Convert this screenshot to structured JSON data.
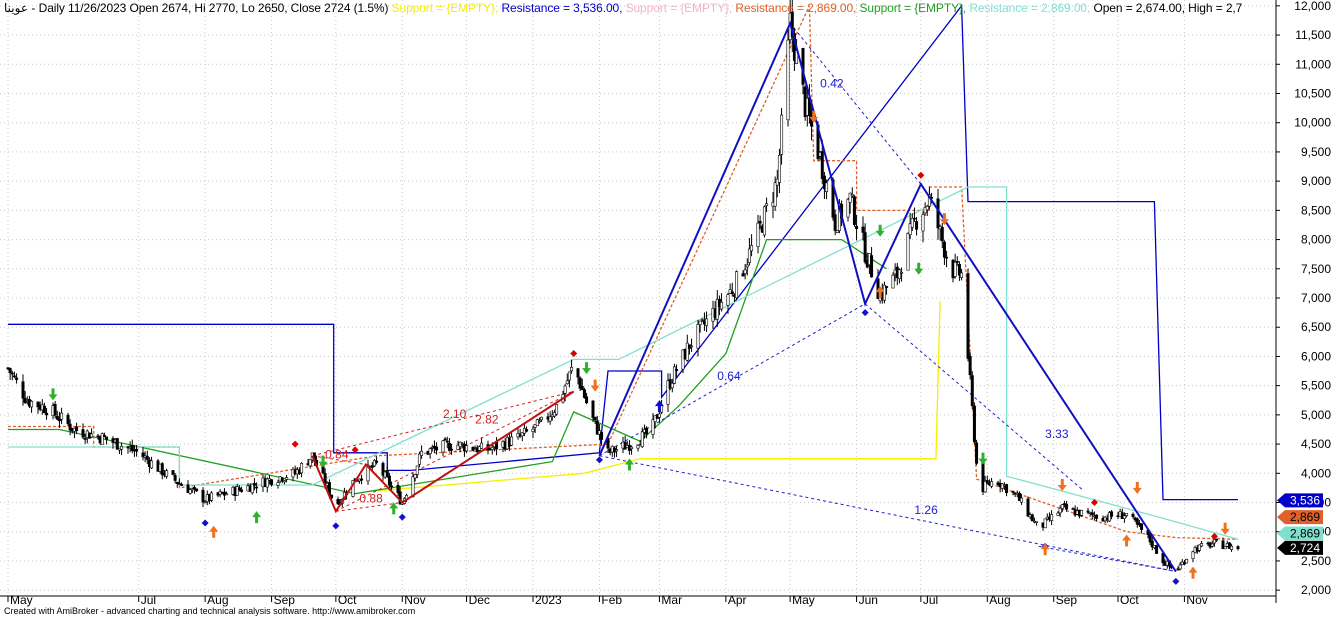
{
  "header": {
    "symbol": "عوينا",
    "summary": " - Daily 11/26/2023 Open 2674, Hi 2770, Lo 2650, Close 2724 (1.5%) ",
    "items": [
      {
        "text": "Support = {EMPTY}, ",
        "color": "#f4f000"
      },
      {
        "text": "Resistance = 3,536.00, ",
        "color": "#0000c8"
      },
      {
        "text": "Support = {EMPTY}, ",
        "color": "#f4b4c4"
      },
      {
        "text": "Resistance = 2,869.00, ",
        "color": "#e0602a"
      },
      {
        "text": "Support = {EMPTY}, ",
        "color": "#20a020"
      },
      {
        "text": "Resistance = 2,869.00, ",
        "color": "#80e0d0"
      },
      {
        "text": "Open = 2,674.00, High = 2,7",
        "color": "#000000"
      }
    ]
  },
  "footer": "Created with AmiBroker - advanced charting and technical analysis software. http://www.amibroker.com",
  "chart_data": {
    "type": "candlestick",
    "ylim": [
      1900,
      12100
    ],
    "yticks": [
      2000,
      2500,
      3000,
      3500,
      4000,
      4500,
      5000,
      5500,
      6000,
      6500,
      7000,
      7500,
      8000,
      8500,
      9000,
      9500,
      10000,
      10500,
      11000,
      11500,
      12000
    ],
    "ytick_labels": [
      "2,000",
      "2,500",
      "3,000",
      "3,500",
      "4,000",
      "4,500",
      "5,000",
      "5,500",
      "6,000",
      "6,500",
      "7,000",
      "7,500",
      "8,000",
      "8,500",
      "9,000",
      "9,500",
      "10,000",
      "10,500",
      "11,000",
      "11,500",
      "12,000"
    ],
    "months": [
      {
        "label": "May",
        "date": "2022-05-01"
      },
      {
        "label": "Jul",
        "date": "2022-07-01"
      },
      {
        "label": "Aug",
        "date": "2022-08-01"
      },
      {
        "label": "Sep",
        "date": "2022-09-01"
      },
      {
        "label": "Oct",
        "date": "2022-10-01"
      },
      {
        "label": "Nov",
        "date": "2022-11-01"
      },
      {
        "label": "Dec",
        "date": "2022-12-01"
      },
      {
        "label": "2023",
        "date": "2023-01-01"
      },
      {
        "label": "Feb",
        "date": "2023-02-01"
      },
      {
        "label": "Mar",
        "date": "2023-03-01"
      },
      {
        "label": "Apr",
        "date": "2023-04-01"
      },
      {
        "label": "May",
        "date": "2023-05-01"
      },
      {
        "label": "Jun",
        "date": "2023-06-01"
      },
      {
        "label": "Jul",
        "date": "2023-07-01"
      },
      {
        "label": "Aug",
        "date": "2023-08-01"
      },
      {
        "label": "Sep",
        "date": "2023-09-01"
      },
      {
        "label": "Oct",
        "date": "2023-10-01"
      },
      {
        "label": "Nov",
        "date": "2023-11-01"
      }
    ],
    "date_range": [
      "2022-05-01",
      "2023-11-26"
    ],
    "price_path": [
      [
        "2022-05-01",
        5800
      ],
      [
        "2022-05-10",
        5250
      ],
      [
        "2022-05-20",
        5100
      ],
      [
        "2022-06-01",
        4750
      ],
      [
        "2022-06-15",
        4600
      ],
      [
        "2022-07-01",
        4350
      ],
      [
        "2022-07-15",
        3950
      ],
      [
        "2022-08-01",
        3550
      ],
      [
        "2022-08-15",
        3700
      ],
      [
        "2022-09-01",
        3900
      ],
      [
        "2022-09-12",
        4000
      ],
      [
        "2022-09-20",
        4300
      ],
      [
        "2022-10-01",
        3450
      ],
      [
        "2022-10-10",
        3900
      ],
      [
        "2022-10-20",
        4150
      ],
      [
        "2022-11-01",
        3500
      ],
      [
        "2022-11-10",
        4350
      ],
      [
        "2022-11-25",
        4500
      ],
      [
        "2022-12-10",
        4400
      ],
      [
        "2022-12-25",
        4600
      ],
      [
        "2023-01-05",
        4850
      ],
      [
        "2023-01-12",
        5150
      ],
      [
        "2023-01-20",
        5850
      ],
      [
        "2023-01-28",
        5000
      ],
      [
        "2023-02-05",
        4350
      ],
      [
        "2023-02-15",
        4500
      ],
      [
        "2023-02-25",
        4700
      ],
      [
        "2023-03-05",
        5500
      ],
      [
        "2023-03-15",
        6200
      ],
      [
        "2023-03-25",
        6700
      ],
      [
        "2023-04-05",
        7200
      ],
      [
        "2023-04-15",
        8000
      ],
      [
        "2023-04-25",
        9000
      ],
      [
        "2023-05-01",
        11700
      ],
      [
        "2023-05-08",
        10300
      ],
      [
        "2023-05-15",
        9400
      ],
      [
        "2023-05-22",
        8300
      ],
      [
        "2023-05-29",
        8700
      ],
      [
        "2023-06-05",
        7800
      ],
      [
        "2023-06-12",
        7050
      ],
      [
        "2023-06-20",
        7400
      ],
      [
        "2023-06-28",
        8300
      ],
      [
        "2023-07-05",
        8700
      ],
      [
        "2023-07-15",
        7500
      ],
      [
        "2023-07-20",
        7400
      ],
      [
        "2023-07-28",
        3700
      ],
      [
        "2023-08-05",
        3900
      ],
      [
        "2023-08-15",
        3600
      ],
      [
        "2023-08-25",
        3050
      ],
      [
        "2023-09-05",
        3400
      ],
      [
        "2023-09-15",
        3300
      ],
      [
        "2023-09-25",
        3250
      ],
      [
        "2023-10-05",
        3300
      ],
      [
        "2023-10-15",
        2900
      ],
      [
        "2023-10-22",
        2500
      ],
      [
        "2023-10-28",
        2320
      ],
      [
        "2023-11-05",
        2700
      ],
      [
        "2023-11-15",
        2800
      ],
      [
        "2023-11-26",
        2724
      ]
    ],
    "zigzag_blue": [
      [
        "2023-02-01",
        4300
      ],
      [
        "2023-05-01",
        11700
      ],
      [
        "2023-06-05",
        6900
      ],
      [
        "2023-07-01",
        8950
      ],
      [
        "2023-10-28",
        2320
      ]
    ],
    "zigzag_red": [
      [
        "2022-09-20",
        4300
      ],
      [
        "2022-10-01",
        3350
      ],
      [
        "2022-10-15",
        4150
      ],
      [
        "2022-11-01",
        3500
      ],
      [
        "2023-01-20",
        5400
      ]
    ],
    "ratio_lines_blue": [
      {
        "from": [
          "2023-05-01",
          11700
        ],
        "to": [
          "2023-07-01",
          8950
        ],
        "label": "0.42",
        "at": [
          "2023-05-15",
          10600
        ]
      },
      {
        "from": [
          "2023-02-01",
          4300
        ],
        "to": [
          "2023-06-05",
          6900
        ],
        "label": "0.64",
        "at": [
          "2023-03-28",
          5600
        ]
      },
      {
        "from": [
          "2023-06-05",
          6900
        ],
        "to": [
          "2023-09-15",
          3700
        ],
        "label": "3.33",
        "at": [
          "2023-08-28",
          4600
        ]
      },
      {
        "from": [
          "2023-02-01",
          4300
        ],
        "to": [
          "2023-10-28",
          2320
        ],
        "label": "1.26",
        "at": [
          "2023-06-28",
          3300
        ]
      },
      {
        "from": [
          "2023-08-25",
          2750
        ],
        "to": [
          "2023-10-28",
          2320
        ],
        "label": "",
        "at": null
      }
    ],
    "ratio_lines_red": [
      {
        "from": [
          "2022-09-20",
          4300
        ],
        "to": [
          "2023-01-20",
          5400
        ],
        "label": "2.10",
        "at": [
          "2022-11-20",
          4950
        ]
      },
      {
        "from": [
          "2022-10-01",
          3350
        ],
        "to": [
          "2023-01-20",
          5400
        ],
        "label": "2.82",
        "at": [
          "2022-12-05",
          4850
        ]
      },
      {
        "from": [
          "2022-09-20",
          4300
        ],
        "to": [
          "2022-10-15",
          4150
        ],
        "label": "0.84",
        "at": [
          "2022-09-26",
          4250
        ]
      },
      {
        "from": [
          "2022-10-01",
          3350
        ],
        "to": [
          "2022-11-01",
          3500
        ],
        "label": "0.88",
        "at": [
          "2022-10-12",
          3500
        ]
      }
    ],
    "series": [
      {
        "name": "Resistance",
        "color": "#0000c8",
        "points": [
          [
            "2022-05-01",
            6550
          ],
          [
            "2022-09-30",
            6550
          ],
          [
            "2022-09-30",
            4350
          ],
          [
            "2022-10-25",
            4350
          ],
          [
            "2022-10-25",
            4050
          ],
          [
            "2022-11-05",
            4050
          ],
          [
            "2023-02-01",
            4350
          ],
          [
            "2023-02-05",
            5750
          ],
          [
            "2023-03-02",
            5750
          ],
          [
            "2023-03-02",
            5300
          ],
          [
            "2023-07-20",
            12000
          ],
          [
            "2023-07-23",
            8650
          ],
          [
            "2023-10-18",
            8650
          ],
          [
            "2023-10-22",
            3550
          ],
          [
            "2023-11-26",
            3550
          ]
        ]
      },
      {
        "name": "Resistance",
        "color": "#e0602a",
        "points": [
          [
            "2022-05-01",
            4800
          ],
          [
            "2022-06-10",
            4800
          ],
          [
            "2022-06-10",
            4450
          ],
          [
            "2022-07-20",
            4450
          ],
          [
            "2022-07-20",
            3750
          ],
          [
            "2022-10-20",
            4300
          ],
          [
            "2023-02-05",
            4500
          ],
          [
            "2023-05-10",
            12000
          ],
          [
            "2023-05-12",
            9350
          ],
          [
            "2023-06-01",
            9350
          ],
          [
            "2023-06-01",
            8500
          ],
          [
            "2023-07-05",
            8500
          ],
          [
            "2023-07-05",
            8900
          ],
          [
            "2023-07-20",
            8900
          ],
          [
            "2023-07-27",
            3900
          ],
          [
            "2023-10-05",
            3000
          ],
          [
            "2023-10-28",
            2900
          ],
          [
            "2023-11-26",
            2870
          ]
        ]
      },
      {
        "name": "Support",
        "color": "#f4f000",
        "points": [
          [
            "2022-10-20",
            3700
          ],
          [
            "2023-01-25",
            4000
          ],
          [
            "2023-02-20",
            4250
          ],
          [
            "2023-07-08",
            4250
          ],
          [
            "2023-07-10",
            6950
          ]
        ]
      },
      {
        "name": "Support",
        "color": "#20a020",
        "points": [
          [
            "2022-05-01",
            4750
          ],
          [
            "2022-05-25",
            4750
          ],
          [
            "2022-10-10",
            3650
          ],
          [
            "2023-01-10",
            4200
          ],
          [
            "2023-01-20",
            5050
          ],
          [
            "2023-02-20",
            4550
          ],
          [
            "2023-03-10",
            5150
          ],
          [
            "2023-04-01",
            6050
          ],
          [
            "2023-04-20",
            8000
          ],
          [
            "2023-05-25",
            8000
          ],
          [
            "2023-06-15",
            7500
          ]
        ]
      },
      {
        "name": "Resistance",
        "color": "#80e0d0",
        "points": [
          [
            "2022-05-01",
            4450
          ],
          [
            "2022-07-20",
            4450
          ],
          [
            "2022-07-20",
            3800
          ],
          [
            "2022-09-20",
            3800
          ],
          [
            "2023-01-20",
            5950
          ],
          [
            "2023-02-10",
            5950
          ],
          [
            "2023-07-23",
            8900
          ],
          [
            "2023-08-10",
            8900
          ],
          [
            "2023-08-10",
            3950
          ],
          [
            "2023-10-20",
            3250
          ],
          [
            "2023-11-26",
            2870
          ]
        ]
      }
    ],
    "peaks": [
      [
        "2022-09-12",
        4500
      ],
      [
        "2022-10-10",
        4400
      ],
      [
        "2023-01-20",
        6050
      ],
      [
        "2023-07-01",
        9100
      ],
      [
        "2023-09-20",
        3500
      ],
      [
        "2023-11-15",
        2920
      ]
    ],
    "troughs": [
      [
        "2022-08-01",
        3150
      ],
      [
        "2022-10-01",
        3100
      ],
      [
        "2022-11-01",
        3250
      ],
      [
        "2023-02-01",
        4230
      ],
      [
        "2023-06-05",
        6750
      ],
      [
        "2023-08-28",
        2750
      ],
      [
        "2023-10-28",
        2150
      ]
    ],
    "arrows_up_orange": [
      [
        "2022-08-05",
        3000
      ],
      [
        "2023-06-12",
        7100
      ],
      [
        "2023-08-28",
        2700
      ],
      [
        "2023-10-05",
        2850
      ],
      [
        "2023-11-05",
        2300
      ]
    ],
    "arrows_down_orange": [
      [
        "2023-01-30",
        5500
      ],
      [
        "2023-05-12",
        10100
      ],
      [
        "2023-07-12",
        8350
      ],
      [
        "2023-09-05",
        3800
      ],
      [
        "2023-10-10",
        3750
      ],
      [
        "2023-11-20",
        3050
      ]
    ],
    "arrows_up_green": [
      [
        "2022-08-25",
        3250
      ],
      [
        "2022-10-28",
        3400
      ],
      [
        "2023-02-15",
        4150
      ]
    ],
    "arrows_down_green": [
      [
        "2022-05-22",
        5350
      ],
      [
        "2022-09-25",
        4200
      ],
      [
        "2023-01-26",
        5800
      ],
      [
        "2023-06-12",
        8150
      ],
      [
        "2023-06-30",
        7500
      ],
      [
        "2023-07-30",
        4250
      ]
    ],
    "arrows_up_blue": [
      [
        "2023-03-01",
        5150
      ]
    ],
    "value_labels": [
      {
        "text": "3,536",
        "value": 3536,
        "bg": "#0000c8",
        "fg": "#ffffff"
      },
      {
        "text": "2,869",
        "value": 3250,
        "bg": "#e0602a",
        "fg": "#000000"
      },
      {
        "text": "2,869",
        "value": 2970,
        "bg": "#80e0d0",
        "fg": "#000000"
      },
      {
        "text": "2,724",
        "value": 2724,
        "bg": "#000000",
        "fg": "#ffffff"
      }
    ]
  }
}
